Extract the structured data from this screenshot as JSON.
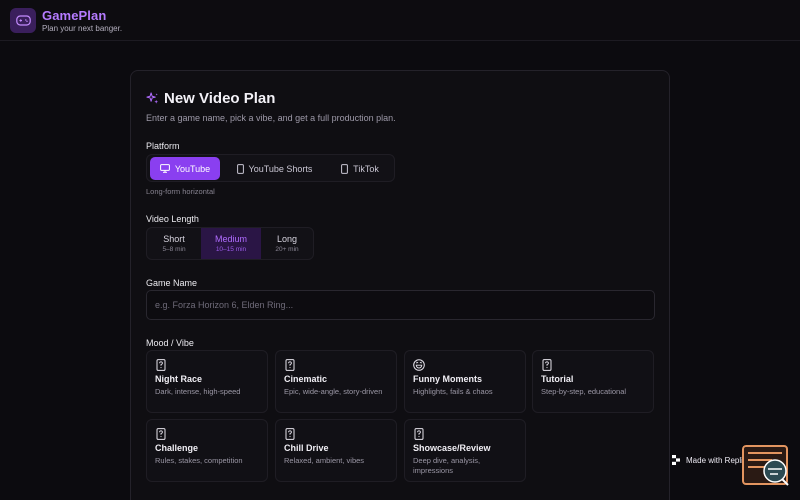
{
  "app": {
    "name": "GamePlan",
    "tagline": "Plan your next banger.",
    "brand_color": "#b57bff",
    "logo_icon": "gamepad-icon"
  },
  "form": {
    "title": "New Video Plan",
    "subtitle": "Enter a game name, pick a vibe, and get a full production plan.",
    "platform": {
      "label": "Platform",
      "options": [
        {
          "label": "YouTube",
          "icon": "monitor-icon",
          "selected": true
        },
        {
          "label": "YouTube Shorts",
          "icon": "phone-icon",
          "selected": false
        },
        {
          "label": "TikTok",
          "icon": "phone-icon",
          "selected": false
        }
      ],
      "hint": "Long-form horizontal"
    },
    "length": {
      "label": "Video Length",
      "options": [
        {
          "label": "Short",
          "sub": "5–8 min",
          "selected": false
        },
        {
          "label": "Medium",
          "sub": "10–15 min",
          "selected": true
        },
        {
          "label": "Long",
          "sub": "20+ min",
          "selected": false
        }
      ]
    },
    "game": {
      "label": "Game Name",
      "placeholder": "e.g. Forza Horizon 6, Elden Ring...",
      "value": ""
    },
    "mood": {
      "label": "Mood / Vibe",
      "options": [
        {
          "title": "Night Race",
          "desc": "Dark, intense, high-speed",
          "icon": "card-icon"
        },
        {
          "title": "Cinematic",
          "desc": "Epic, wide-angle, story-driven",
          "icon": "card-icon"
        },
        {
          "title": "Funny Moments",
          "desc": "Highlights, fails & chaos",
          "icon": "laugh-icon"
        },
        {
          "title": "Tutorial",
          "desc": "Step-by-step, educational",
          "icon": "card-icon"
        },
        {
          "title": "Challenge",
          "desc": "Rules, stakes, competition",
          "icon": "card-icon"
        },
        {
          "title": "Chill Drive",
          "desc": "Relaxed, ambient, vibes",
          "icon": "card-icon"
        },
        {
          "title": "Showcase/Review",
          "desc": "Deep dive, analysis, impressions",
          "icon": "card-icon"
        }
      ]
    }
  },
  "badge": {
    "label": "Made with Replit"
  },
  "colors": {
    "accent": "#8a3ff0",
    "accent_soft": "#2a1545",
    "background": "#0c0b0f",
    "card": "#0f0e12"
  }
}
